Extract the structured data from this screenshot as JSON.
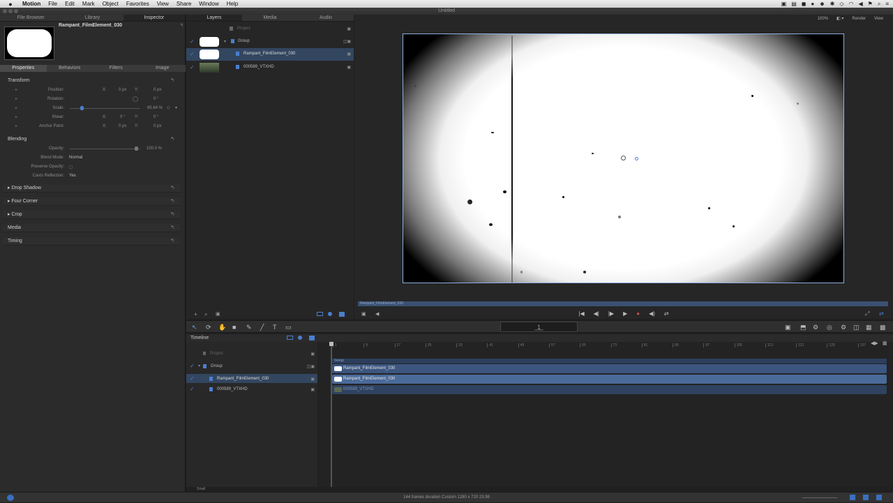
{
  "menubar": {
    "apple": "",
    "app": "Motion",
    "items": [
      "File",
      "Edit",
      "Mark",
      "Object",
      "Favorites",
      "View",
      "Share",
      "Window",
      "Help"
    ],
    "icons": [
      "camera-icon",
      "pdf-icon",
      "app-icon",
      "circle-icon",
      "person-icon",
      "bluetooth-icon",
      "network-icon",
      "wifi-icon",
      "volume-icon",
      "flag-icon",
      "search-icon",
      "list-icon"
    ]
  },
  "window": {
    "title": "Untitled"
  },
  "left": {
    "tabs": [
      "File Browser",
      "Library",
      "Inspector"
    ],
    "selected_name": "Rampant_FilmElement_030",
    "subtabs": [
      "Properties",
      "Behaviors",
      "Filters",
      "Image"
    ],
    "transform": {
      "title": "Transform",
      "rows": [
        {
          "label": "Position:",
          "x_lbl": "X:",
          "x": "0 px",
          "y_lbl": "Y:",
          "y": "0 px"
        },
        {
          "label": "Rotation:",
          "val": "0 °"
        },
        {
          "label": "Scale:",
          "val": "65.64 %"
        },
        {
          "label": "Shear:",
          "x_lbl": "X:",
          "x": "0 °",
          "y_lbl": "Y:",
          "y": "0 °"
        },
        {
          "label": "Anchor Point:",
          "x_lbl": "X:",
          "x": "0 px",
          "y_lbl": "Y:",
          "y": "0 px"
        }
      ]
    },
    "blending": {
      "title": "Blending",
      "rows": [
        {
          "label": "Opacity:",
          "val": "100.0 %"
        },
        {
          "label": "Blend Mode:",
          "val": "Normal"
        },
        {
          "label": "Preserve Opacity:",
          "val": ""
        },
        {
          "label": "Casts Reflection:",
          "val": "Yes"
        }
      ]
    },
    "sections": [
      "Drop Shadow",
      "Four Corner",
      "Crop",
      "Media",
      "Timing"
    ],
    "reset": "↰"
  },
  "layers": {
    "tabs": [
      "Layers",
      "Media",
      "Audio"
    ],
    "project": "Project",
    "items": [
      {
        "name": "Group"
      },
      {
        "name": "Rampant_FilmElement_030"
      },
      {
        "name": "000589_VTXHD"
      }
    ]
  },
  "viewer": {
    "zoom": "100%",
    "render": "Render",
    "view": "View",
    "scrub_label": "Rampant_FilmElement_030"
  },
  "timeline": {
    "title": "Timeline",
    "project": "Project",
    "items": [
      "Group",
      "Rampant_FilmElement_030",
      "000589_VTXHD"
    ],
    "ruler": [
      "1",
      "9",
      "17",
      "25",
      "33",
      "41",
      "49",
      "57",
      "65",
      "73",
      "81",
      "89",
      "97",
      "105",
      "113",
      "121",
      "129",
      "137"
    ],
    "group_label": "Group",
    "clips": [
      "Rampant_FilmElement_030",
      "Rampant_FilmElement_030",
      "000589_VTXHD"
    ],
    "timecode": "1",
    "timecode_sub": "FRAMES",
    "zoom_label": "Small"
  },
  "status": {
    "text": "144 frames duration Custom 1280 x 720 23.98"
  },
  "colors": {
    "accent": "#4a7fd0",
    "selection": "#334660",
    "clip": "#3c5680"
  }
}
